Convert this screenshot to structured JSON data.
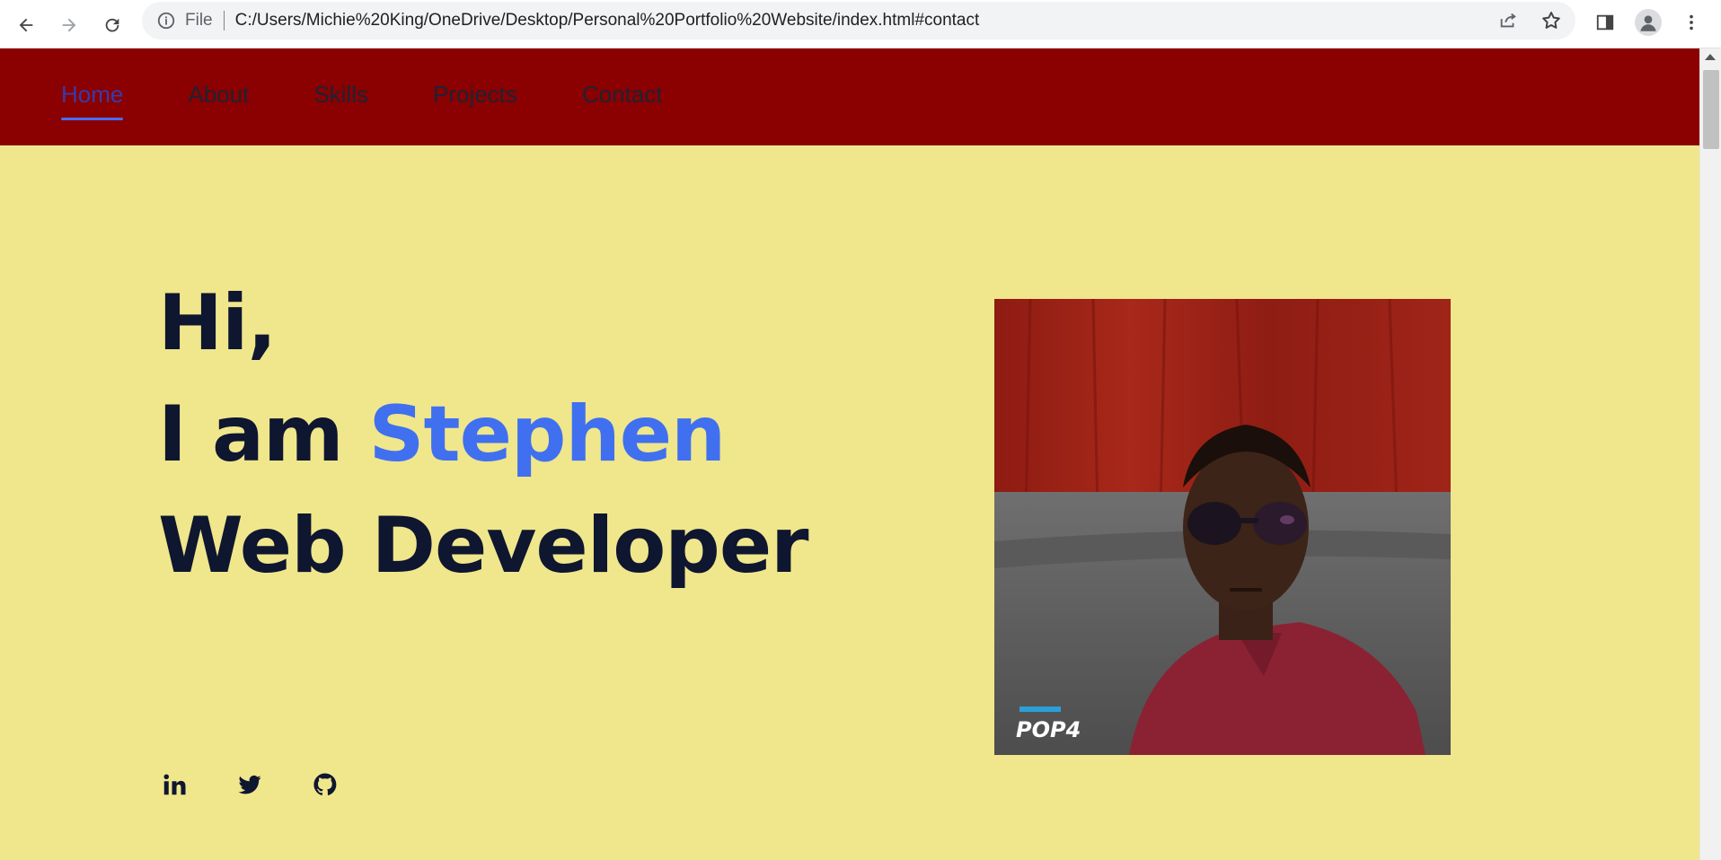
{
  "browser": {
    "back_icon": "back-arrow-icon",
    "forward_icon": "forward-arrow-icon",
    "reload_icon": "reload-icon",
    "scheme_label": "File",
    "url": "C:/Users/Michie%20King/OneDrive/Desktop/Personal%20Portfolio%20Website/index.html#contact"
  },
  "site_nav": {
    "items": [
      {
        "label": "Home",
        "active": true
      },
      {
        "label": "About"
      },
      {
        "label": "Skills"
      },
      {
        "label": "Projects"
      },
      {
        "label": "Contact"
      }
    ]
  },
  "hero": {
    "greeting": "Hi,",
    "intro_prefix": "I am ",
    "name": "Stephen",
    "role": "Web Developer",
    "photo_watermark": "POP4"
  },
  "socials": [
    {
      "name": "linkedin-icon"
    },
    {
      "name": "twitter-icon"
    },
    {
      "name": "github-icon"
    }
  ],
  "colors": {
    "header_bg": "#8b0000",
    "hero_bg": "#f0e68c",
    "accent": "#4070f0",
    "text_dark": "#0e1630"
  }
}
